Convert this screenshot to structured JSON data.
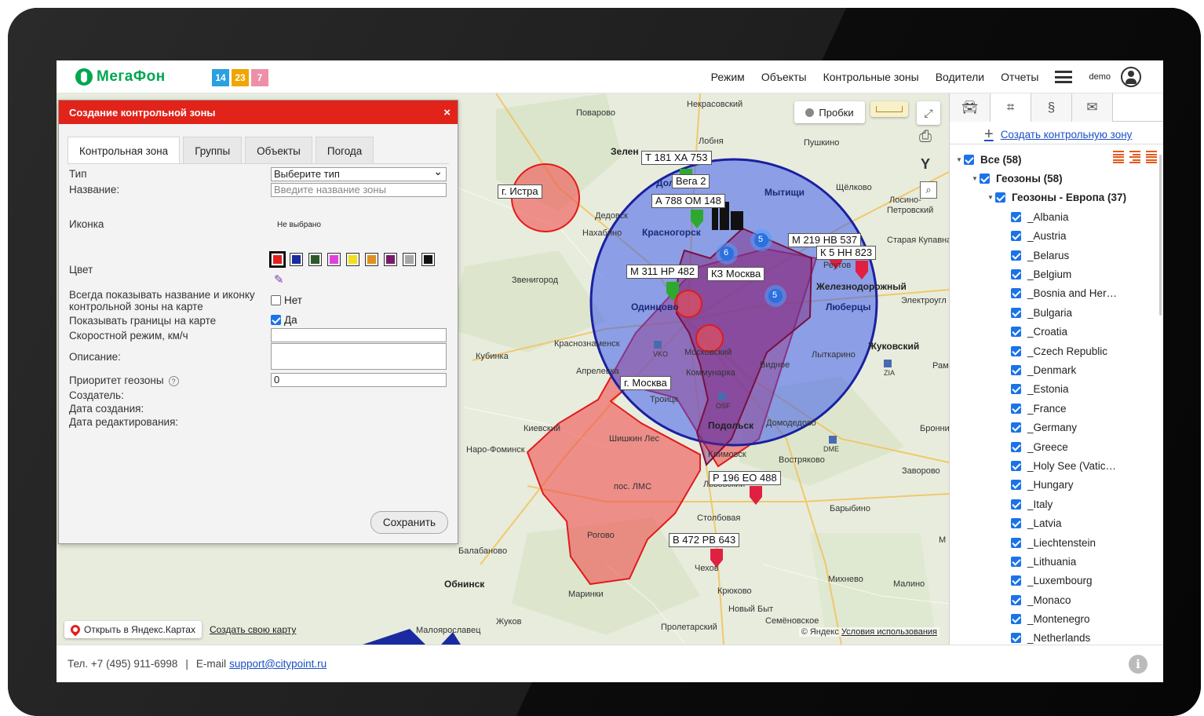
{
  "header": {
    "logo_text": "МегаФон",
    "badges": [
      {
        "value": "14",
        "color": "#2aa0e0"
      },
      {
        "value": "23",
        "color": "#f0a500"
      },
      {
        "value": "7",
        "color": "#ee8fa8"
      }
    ],
    "nav": [
      "Режим",
      "Объекты",
      "Контрольные зоны",
      "Водители",
      "Отчеты"
    ],
    "user": "demo"
  },
  "map": {
    "traffic_button": "Пробки",
    "labels": {
      "nekrasovsky": "Некрасовский",
      "povarovo": "Поварово",
      "zelenograd": "Зелен",
      "lobnya": "Лобня",
      "pushkino": "Пушкино",
      "dolgoprudny": "Долгопр",
      "mytishchi": "Мытищи",
      "shchelkovo": "Щёлково",
      "losino": "Лосино-",
      "petrovsky": "Петровский",
      "dedovsk": "Дедовск",
      "nakhabino": "Нахабино",
      "krasnogorsk": "Красногорск",
      "kupavna": "Старая Купавна",
      "reutov": "Реутов",
      "zvenigorod": "Звенигород",
      "zheleznodorozhny": "Железнодорожный",
      "odintsovo": "Одинцово",
      "elektrougli": "Электроугл",
      "lyubertsy": "Люберцы",
      "krasnoznamensk": "Краснознаменск",
      "kubinka": "Кубинка",
      "moskovsky": "Московский",
      "zhukovsky": "Жуковский",
      "aprelevka": "Апрелевка",
      "kommunarka": "Коммунарка",
      "vidnoe": "Видное",
      "lytkarino": "Лыткарино",
      "ram": "Рам",
      "troitsk": "Троицк",
      "kievsky": "Киевский",
      "podolsk": "Подольск",
      "domodedovo": "Домодедово",
      "bronnitsy": "Бронни",
      "shishkin": "Шишкин Лес",
      "naro": "Наро-Фоминск",
      "klimovsk": "Климовск",
      "vostryakovo": "Востряково",
      "zavorovo": "Заворово",
      "lvovsky": "Львовский",
      "lms": "пос. ЛМС",
      "barybino": "Барыбино",
      "stolbovaya": "Столбовая",
      "rogovo": "Рогово",
      "balabanovo": "Балабаново",
      "chekhov": "Чехов",
      "obninsk": "Обнинск",
      "mikhnevo": "Михнево",
      "malino": "Малино",
      "mariinka": "Маринки",
      "kryukovo": "Крюково",
      "novy_byt": "Новый Быт",
      "zhukov": "Жуков",
      "proletarsky": "Пролетарский",
      "semenovskoe": "Семёновское",
      "maloyaroslavets": "Малоярославец",
      "m": "М",
      "vko": "VKO",
      "zia": "ZIA",
      "osf": "OSF",
      "dme": "DME"
    },
    "tags": {
      "istra": "г. Истра",
      "t181": "Т 181 ХА 753",
      "vega": "Вега 2",
      "a788": "А 788 ОМ 148",
      "m219": "М 219 НВ 537",
      "k823": "К 5 НН 823",
      "m311": "М 311 НР 482",
      "kz": "КЗ Москва",
      "moskva": "г. Москва",
      "p196": "Р 196 ЕО 488",
      "b472": "В 472 РВ 643"
    },
    "clusters": [
      "5",
      "6",
      "5"
    ],
    "open_yandex": "Открыть в Яндекс.Картах",
    "make_map": "Создать свою карту",
    "copyright": "© Яндекс",
    "terms": "Условия использования"
  },
  "dialog": {
    "title": "Создание контрольной зоны",
    "close": "×",
    "tabs": [
      "Контрольная зона",
      "Группы",
      "Объекты",
      "Погода"
    ],
    "fields": {
      "type_label": "Тип",
      "type_value": "Выберите тип",
      "name_label": "Название:",
      "name_placeholder": "Введите название зоны",
      "icon_label": "Иконка",
      "icon_value": "Не выбрано",
      "color_label": "Цвет",
      "always_show_label_1": "Всегда показывать название и иконку",
      "always_show_label_2": "контрольной зоны на карте",
      "always_show_value": "Нет",
      "borders_label": "Показывать границы на карте",
      "borders_value": "Да",
      "speed_label": "Скоростной режим, км/ч",
      "desc_label": "Описание:",
      "priority_label": "Приоритет геозоны",
      "priority_help": "?",
      "priority_value": "0",
      "creator_label": "Создатель:",
      "created_label": "Дата создания:",
      "edited_label": "Дата редактирования:"
    },
    "colors": [
      "#e02020",
      "#1a2aa0",
      "#2a5a2a",
      "#e040e0",
      "#f0e020",
      "#e09020",
      "#7a1a6a",
      "#a8a8a8",
      "#111111"
    ],
    "save": "Сохранить"
  },
  "panel": {
    "create_zone": "Создать контрольную зону",
    "tree": [
      {
        "label": "Все (58)",
        "level": 0,
        "bold": true,
        "arrow": true
      },
      {
        "label": "Геозоны (58)",
        "level": 1,
        "bold": true,
        "arrow": true
      },
      {
        "label": "Геозоны - Европа (37)",
        "level": 2,
        "bold": true,
        "arrow": true
      },
      {
        "label": "_Albania",
        "level": 3
      },
      {
        "label": "_Austria",
        "level": 3
      },
      {
        "label": "_Belarus",
        "level": 3
      },
      {
        "label": "_Belgium",
        "level": 3
      },
      {
        "label": "_Bosnia and Her…",
        "level": 3
      },
      {
        "label": "_Bulgaria",
        "level": 3
      },
      {
        "label": "_Croatia",
        "level": 3
      },
      {
        "label": "_Czech Republic",
        "level": 3
      },
      {
        "label": "_Denmark",
        "level": 3
      },
      {
        "label": "_Estonia",
        "level": 3
      },
      {
        "label": "_France",
        "level": 3
      },
      {
        "label": "_Germany",
        "level": 3
      },
      {
        "label": "_Greece",
        "level": 3
      },
      {
        "label": "_Holy See (Vatic…",
        "level": 3
      },
      {
        "label": "_Hungary",
        "level": 3
      },
      {
        "label": "_Italy",
        "level": 3
      },
      {
        "label": "_Latvia",
        "level": 3
      },
      {
        "label": "_Liechtenstein",
        "level": 3
      },
      {
        "label": "_Lithuania",
        "level": 3
      },
      {
        "label": "_Luxembourg",
        "level": 3
      },
      {
        "label": "_Monaco",
        "level": 3
      },
      {
        "label": "_Montenegro",
        "level": 3
      },
      {
        "label": "_Netherlands",
        "level": 3
      }
    ]
  },
  "footer": {
    "phone": "Тел. +7 (495) 911-6998",
    "sep": "|",
    "email_label": "E-mail",
    "email": "support@citypoint.ru",
    "info": "i"
  }
}
